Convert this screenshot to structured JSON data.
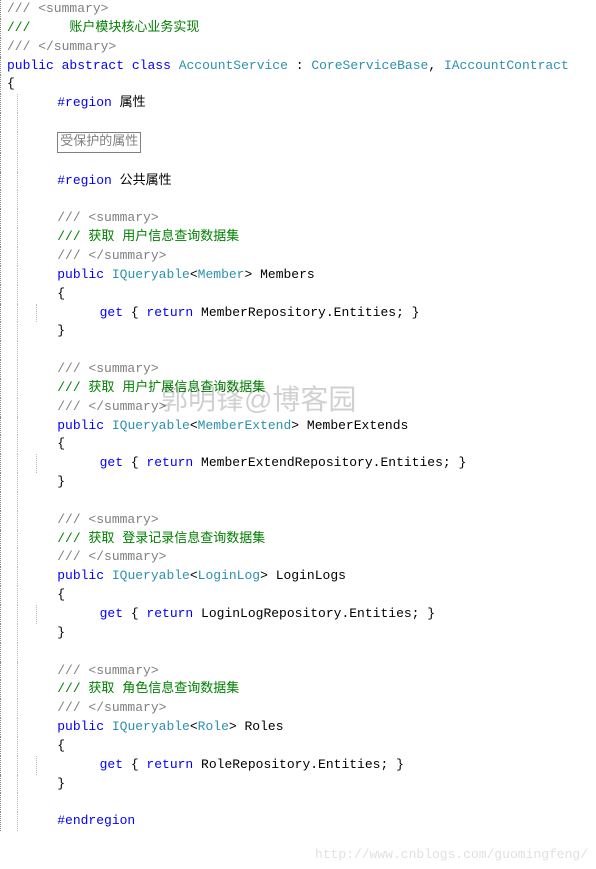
{
  "header": {
    "summary_open": "/// <summary>",
    "summary_text": "///     账户模块核心业务实现",
    "summary_close": "/// </summary>",
    "public": "public",
    "abstract": "abstract",
    "class_kw": "class",
    "class_name": "AccountService",
    "colon": " : ",
    "base1": "CoreServiceBase",
    "comma": ", ",
    "base2": "IAccountContract",
    "brace_open": "{",
    "brace_close": "}"
  },
  "region": {
    "region_kw": "#region",
    "region_props": "属性",
    "collapsed": "受保护的属性",
    "region_pub": "公共属性",
    "endregion": "#endregion"
  },
  "props": [
    {
      "summary_open": "/// <summary>",
      "summary_text": "/// 获取 用户信息查询数据集",
      "summary_close": "/// </summary>",
      "public": "public",
      "iqueryable": "IQueryable",
      "lt": "<",
      "generic": "Member",
      "gt": ">",
      "prop_name": " Members",
      "brace_open": "{",
      "get_kw": "get",
      "get_brace_open": " { ",
      "return_kw": "return",
      "return_val": " MemberRepository.Entities; }",
      "brace_close": "}"
    },
    {
      "summary_open": "/// <summary>",
      "summary_text": "/// 获取 用户扩展信息查询数据集",
      "summary_close": "/// </summary>",
      "public": "public",
      "iqueryable": "IQueryable",
      "lt": "<",
      "generic": "MemberExtend",
      "gt": ">",
      "prop_name": " MemberExtends",
      "brace_open": "{",
      "get_kw": "get",
      "get_brace_open": " { ",
      "return_kw": "return",
      "return_val": " MemberExtendRepository.Entities; }",
      "brace_close": "}"
    },
    {
      "summary_open": "/// <summary>",
      "summary_text": "/// 获取 登录记录信息查询数据集",
      "summary_close": "/// </summary>",
      "public": "public",
      "iqueryable": "IQueryable",
      "lt": "<",
      "generic": "LoginLog",
      "gt": ">",
      "prop_name": " LoginLogs",
      "brace_open": "{",
      "get_kw": "get",
      "get_brace_open": " { ",
      "return_kw": "return",
      "return_val": " LoginLogRepository.Entities; }",
      "brace_close": "}"
    },
    {
      "summary_open": "/// <summary>",
      "summary_text": "/// 获取 角色信息查询数据集",
      "summary_close": "/// </summary>",
      "public": "public",
      "iqueryable": "IQueryable",
      "lt": "<",
      "generic": "Role",
      "gt": ">",
      "prop_name": " Roles",
      "brace_open": "{",
      "get_kw": "get",
      "get_brace_open": " { ",
      "return_kw": "return",
      "return_val": " RoleRepository.Entities; }",
      "brace_close": "}"
    }
  ],
  "watermark": "郭明锋@博客园",
  "footer_url": "http://www.cnblogs.com/guomingfeng/"
}
